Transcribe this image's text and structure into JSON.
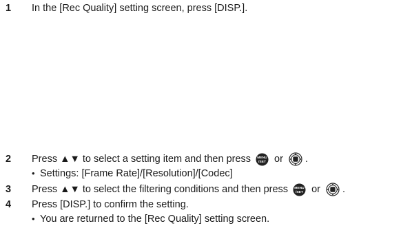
{
  "steps": [
    {
      "num": "1",
      "text": "In the [Rec Quality] setting screen, press [DISP.]."
    },
    {
      "num": "2",
      "text_before": "Press ▲▼ to select a setting item and then press",
      "or": "or",
      "end": "."
    },
    {
      "num": "3",
      "text_before": "Press ▲▼ to select the filtering conditions and then press",
      "or": "or",
      "end": "."
    },
    {
      "num": "4",
      "text": "Press [DISP.] to confirm the setting."
    }
  ],
  "bullets": {
    "step2": "Settings: [Frame Rate]/[Resolution]/[Codec]",
    "step4": "You are returned to the [Rec Quality] setting screen."
  },
  "bullet_char": "•",
  "icons": {
    "menu_set": {
      "name": "menu-set-button-icon",
      "label": "MENU/SET",
      "fill": "#222222"
    },
    "dial": {
      "name": "control-dial-icon"
    }
  }
}
